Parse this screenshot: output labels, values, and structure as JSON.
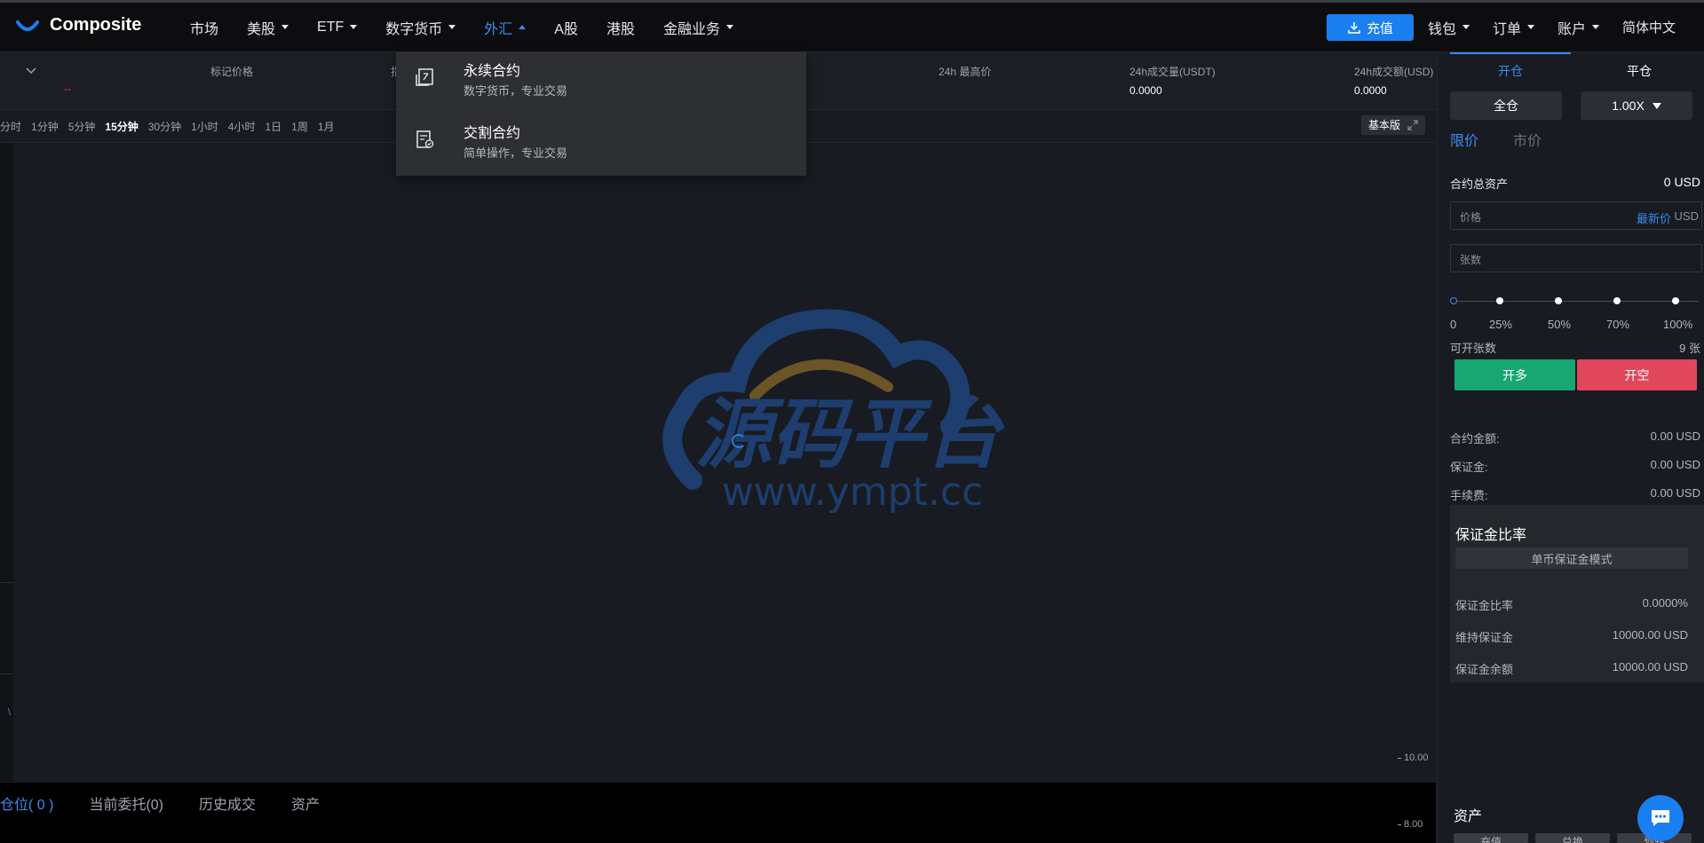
{
  "brand": {
    "name": "Composite"
  },
  "nav": {
    "items": [
      {
        "label": "市场",
        "caret": false
      },
      {
        "label": "美股",
        "caret": true
      },
      {
        "label": "ETF",
        "caret": true
      },
      {
        "label": "数字货币",
        "caret": true
      },
      {
        "label": "外汇",
        "caret": true,
        "active": true
      },
      {
        "label": "A股",
        "caret": false
      },
      {
        "label": "港股",
        "caret": false
      },
      {
        "label": "金融业务",
        "caret": true
      }
    ],
    "deposit_label": "充值",
    "right_items": [
      {
        "label": "钱包",
        "caret": true
      },
      {
        "label": "订单",
        "caret": true
      },
      {
        "label": "账户",
        "caret": true
      }
    ],
    "language": "简体中文"
  },
  "ticker": {
    "mark_price_label": "标记价格",
    "mark_price_value": "--",
    "col2_label_partial": "指",
    "high_label": "24h 最高价",
    "vol_usdt_label": "24h成交量(USDT)",
    "vol_usdt_value": "0.0000",
    "vol_usd_label": "24h成交额(USD)",
    "vol_usd_value": "0.0000"
  },
  "timeframes": {
    "items": [
      "分时",
      "1分钟",
      "5分钟",
      "15分钟",
      "30分钟",
      "1小时",
      "4小时",
      "1日",
      "1周",
      "1月"
    ],
    "active": "15分钟",
    "mode_label": "基本版"
  },
  "chart": {
    "price_ticks": [
      "10.00",
      "8.00"
    ],
    "side_marker": "\\"
  },
  "dropdown": {
    "items": [
      {
        "title": "永续合约",
        "subtitle": "数字货币，专业交易",
        "icon": "contract-icon"
      },
      {
        "title": "交割合约",
        "subtitle": "简单操作，专业交易",
        "icon": "delivery-icon"
      }
    ]
  },
  "watermark": {
    "title": "源码平台",
    "url": "www.ympt.cc",
    "colors": {
      "cloud": "#1d3e6e",
      "arc": "#6b5426",
      "text": "#1d3e6e"
    }
  },
  "bottom_tabs": {
    "items": [
      "仓位( 0 )",
      "当前委托(0)",
      "历史成交",
      "资产"
    ],
    "active": "仓位( 0 )"
  },
  "panel": {
    "tabs": [
      "开仓",
      "平仓"
    ],
    "active_tab": "开仓",
    "margin_mode": "全仓",
    "leverage": "1.00X",
    "price_types": [
      "限价",
      "市价"
    ],
    "active_price_type": "限价",
    "total_assets_label": "合约总资产",
    "total_assets_value": "0 USD",
    "price_placeholder": "价格",
    "latest_price_label": "最新价",
    "unit_usd": "USD",
    "qty_placeholder": "张数",
    "slider": {
      "value_percent": 0,
      "marks": [
        "0",
        "25%",
        "50%",
        "70%",
        "100%"
      ]
    },
    "openable_label": "可开张数",
    "openable_value": "9 张",
    "long_label": "开多",
    "short_label": "开空",
    "amount_label": "合约金额:",
    "amount_value": "0.00 USD",
    "margin_label": "保证金:",
    "margin_value": "0.00 USD",
    "fee_label": "手续费:",
    "fee_value": "0.00 USD",
    "margin_ratio_title": "保证金比率",
    "margin_mode_button": "单币保证金模式",
    "ratio_label": "保证金比率",
    "ratio_value": "0.0000%",
    "maint_label": "维持保证金",
    "maint_value": "10000.00 USD",
    "balance_label": "保证金余额",
    "balance_value": "10000.00 USD",
    "assets_title": "资产",
    "asset_buttons": [
      "充值",
      "兑换",
      "划转"
    ]
  },
  "colors": {
    "accent": "#1a7ff0",
    "long": "#18a673",
    "short": "#e0475a",
    "bg": "#181b21"
  }
}
